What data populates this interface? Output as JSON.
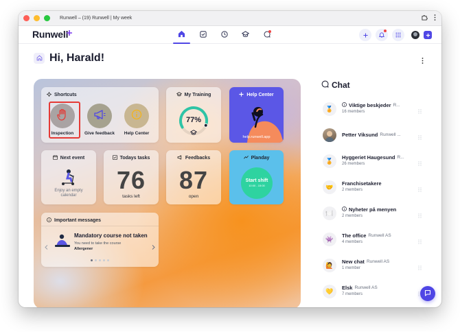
{
  "window": {
    "title": "Runwell – (19) Runwell | My week"
  },
  "app": {
    "logo": "Runwell"
  },
  "nav": {
    "items": [
      {
        "icon": "home-icon",
        "active": true
      },
      {
        "icon": "tasks-icon",
        "active": false
      },
      {
        "icon": "clock-icon",
        "active": false
      },
      {
        "icon": "training-icon",
        "active": false
      },
      {
        "icon": "chat-icon",
        "active": false
      }
    ]
  },
  "page": {
    "greeting": "Hi, Harald!"
  },
  "shortcuts": {
    "title": "Shortcuts",
    "items": [
      {
        "label": "Inspection",
        "icon": "hand-stop-icon"
      },
      {
        "label": "Give feedback",
        "icon": "megaphone-icon"
      },
      {
        "label": "Help Center",
        "icon": "info-icon"
      }
    ]
  },
  "training": {
    "title": "My Training",
    "value_label": "77%",
    "progress": 0.77
  },
  "help_center": {
    "title": "Help Center",
    "url": "help.runwell.app"
  },
  "next_event": {
    "title": "Next event",
    "empty_text": "Enjoy an empty calendar"
  },
  "todays_tasks": {
    "title": "Todays tasks",
    "count": "76",
    "sub": "tasks left"
  },
  "feedbacks": {
    "title": "Feedbacks",
    "count": "87",
    "sub": "open"
  },
  "planday": {
    "title": "Planday",
    "button_label": "Start shift",
    "button_time": "10:00 - 15:00"
  },
  "messages": {
    "title": "Important messages",
    "headline": "Mandatory course not taken",
    "body": "You need to take the course",
    "course": "Allergener",
    "active_dot": 0,
    "dot_count": 5
  },
  "chat": {
    "title": "Chat",
    "items": [
      {
        "name": "Viktige beskjeder",
        "org": "R...",
        "sub": "16 members",
        "info": true,
        "emoji": "🏅"
      },
      {
        "name": "Petter Viksund",
        "org": "Runwell ...",
        "sub": "",
        "info": false,
        "emoji": ""
      },
      {
        "name": "Hyggeriet Haugesund",
        "org": "R...",
        "sub": "26 members",
        "info": false,
        "emoji": "🏅"
      },
      {
        "name": "Franchisetakere",
        "org": "",
        "sub": "2 members",
        "info": false,
        "emoji": "🤝"
      },
      {
        "name": "Nyheter på menyen",
        "org": "",
        "sub": "2 members",
        "info": true,
        "emoji": "🍽️"
      },
      {
        "name": "The office",
        "org": "Runwell AS",
        "sub": "4 members",
        "info": false,
        "emoji": "👾"
      },
      {
        "name": "New chat",
        "org": "Runwell AS",
        "sub": "1 member",
        "info": false,
        "emoji": "🙋"
      },
      {
        "name": "Elsk",
        "org": "Runwell AS",
        "sub": "7 members",
        "info": false,
        "emoji": "💛"
      }
    ]
  },
  "colors": {
    "accent": "#4f46e5",
    "planday": "#5bc0eb",
    "help_center": "#5b57e6",
    "highlight": "#e53935"
  }
}
